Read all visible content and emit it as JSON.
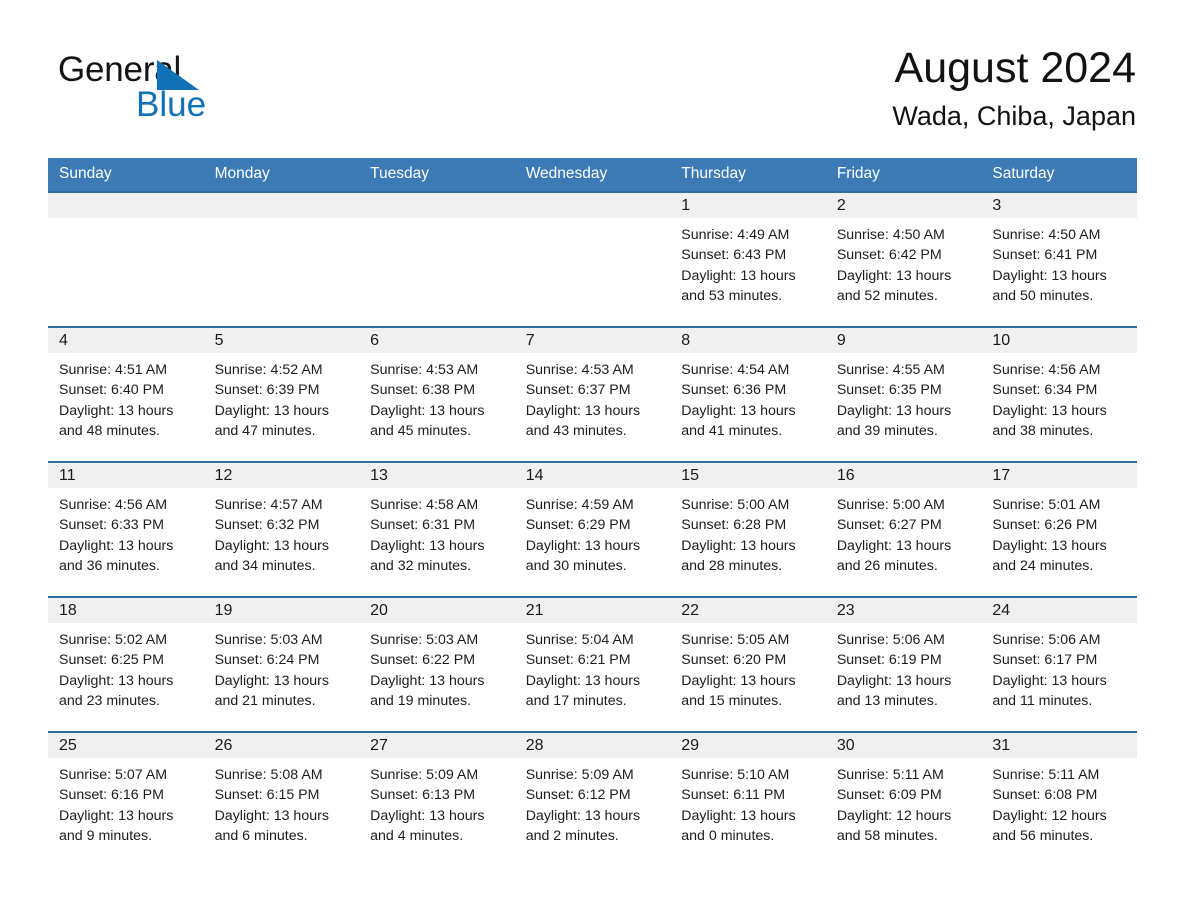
{
  "brand": {
    "name_part1": "General",
    "name_part2": "Blue",
    "triangle_icon": "triangle-icon",
    "accent_color": "#1272b8"
  },
  "header": {
    "month_title": "August 2024",
    "location": "Wada, Chiba, Japan",
    "header_bg_color": "#3b7ab4",
    "row_border_color": "#2e6da4",
    "daynum_band_color": "#f0f0f0"
  },
  "weekday_headers": [
    "Sunday",
    "Monday",
    "Tuesday",
    "Wednesday",
    "Thursday",
    "Friday",
    "Saturday"
  ],
  "labels": {
    "sunrise_prefix": "Sunrise:",
    "sunset_prefix": "Sunset:",
    "daylight_prefix": "Daylight:"
  },
  "weeks": [
    [
      {
        "day": "",
        "empty": true
      },
      {
        "day": "",
        "empty": true
      },
      {
        "day": "",
        "empty": true
      },
      {
        "day": "",
        "empty": true
      },
      {
        "day": "1",
        "sunrise": "Sunrise: 4:49 AM",
        "sunset": "Sunset: 6:43 PM",
        "daylight_line1": "Daylight: 13 hours",
        "daylight_line2": "and 53 minutes."
      },
      {
        "day": "2",
        "sunrise": "Sunrise: 4:50 AM",
        "sunset": "Sunset: 6:42 PM",
        "daylight_line1": "Daylight: 13 hours",
        "daylight_line2": "and 52 minutes."
      },
      {
        "day": "3",
        "sunrise": "Sunrise: 4:50 AM",
        "sunset": "Sunset: 6:41 PM",
        "daylight_line1": "Daylight: 13 hours",
        "daylight_line2": "and 50 minutes."
      }
    ],
    [
      {
        "day": "4",
        "sunrise": "Sunrise: 4:51 AM",
        "sunset": "Sunset: 6:40 PM",
        "daylight_line1": "Daylight: 13 hours",
        "daylight_line2": "and 48 minutes."
      },
      {
        "day": "5",
        "sunrise": "Sunrise: 4:52 AM",
        "sunset": "Sunset: 6:39 PM",
        "daylight_line1": "Daylight: 13 hours",
        "daylight_line2": "and 47 minutes."
      },
      {
        "day": "6",
        "sunrise": "Sunrise: 4:53 AM",
        "sunset": "Sunset: 6:38 PM",
        "daylight_line1": "Daylight: 13 hours",
        "daylight_line2": "and 45 minutes."
      },
      {
        "day": "7",
        "sunrise": "Sunrise: 4:53 AM",
        "sunset": "Sunset: 6:37 PM",
        "daylight_line1": "Daylight: 13 hours",
        "daylight_line2": "and 43 minutes."
      },
      {
        "day": "8",
        "sunrise": "Sunrise: 4:54 AM",
        "sunset": "Sunset: 6:36 PM",
        "daylight_line1": "Daylight: 13 hours",
        "daylight_line2": "and 41 minutes."
      },
      {
        "day": "9",
        "sunrise": "Sunrise: 4:55 AM",
        "sunset": "Sunset: 6:35 PM",
        "daylight_line1": "Daylight: 13 hours",
        "daylight_line2": "and 39 minutes."
      },
      {
        "day": "10",
        "sunrise": "Sunrise: 4:56 AM",
        "sunset": "Sunset: 6:34 PM",
        "daylight_line1": "Daylight: 13 hours",
        "daylight_line2": "and 38 minutes."
      }
    ],
    [
      {
        "day": "11",
        "sunrise": "Sunrise: 4:56 AM",
        "sunset": "Sunset: 6:33 PM",
        "daylight_line1": "Daylight: 13 hours",
        "daylight_line2": "and 36 minutes."
      },
      {
        "day": "12",
        "sunrise": "Sunrise: 4:57 AM",
        "sunset": "Sunset: 6:32 PM",
        "daylight_line1": "Daylight: 13 hours",
        "daylight_line2": "and 34 minutes."
      },
      {
        "day": "13",
        "sunrise": "Sunrise: 4:58 AM",
        "sunset": "Sunset: 6:31 PM",
        "daylight_line1": "Daylight: 13 hours",
        "daylight_line2": "and 32 minutes."
      },
      {
        "day": "14",
        "sunrise": "Sunrise: 4:59 AM",
        "sunset": "Sunset: 6:29 PM",
        "daylight_line1": "Daylight: 13 hours",
        "daylight_line2": "and 30 minutes."
      },
      {
        "day": "15",
        "sunrise": "Sunrise: 5:00 AM",
        "sunset": "Sunset: 6:28 PM",
        "daylight_line1": "Daylight: 13 hours",
        "daylight_line2": "and 28 minutes."
      },
      {
        "day": "16",
        "sunrise": "Sunrise: 5:00 AM",
        "sunset": "Sunset: 6:27 PM",
        "daylight_line1": "Daylight: 13 hours",
        "daylight_line2": "and 26 minutes."
      },
      {
        "day": "17",
        "sunrise": "Sunrise: 5:01 AM",
        "sunset": "Sunset: 6:26 PM",
        "daylight_line1": "Daylight: 13 hours",
        "daylight_line2": "and 24 minutes."
      }
    ],
    [
      {
        "day": "18",
        "sunrise": "Sunrise: 5:02 AM",
        "sunset": "Sunset: 6:25 PM",
        "daylight_line1": "Daylight: 13 hours",
        "daylight_line2": "and 23 minutes."
      },
      {
        "day": "19",
        "sunrise": "Sunrise: 5:03 AM",
        "sunset": "Sunset: 6:24 PM",
        "daylight_line1": "Daylight: 13 hours",
        "daylight_line2": "and 21 minutes."
      },
      {
        "day": "20",
        "sunrise": "Sunrise: 5:03 AM",
        "sunset": "Sunset: 6:22 PM",
        "daylight_line1": "Daylight: 13 hours",
        "daylight_line2": "and 19 minutes."
      },
      {
        "day": "21",
        "sunrise": "Sunrise: 5:04 AM",
        "sunset": "Sunset: 6:21 PM",
        "daylight_line1": "Daylight: 13 hours",
        "daylight_line2": "and 17 minutes."
      },
      {
        "day": "22",
        "sunrise": "Sunrise: 5:05 AM",
        "sunset": "Sunset: 6:20 PM",
        "daylight_line1": "Daylight: 13 hours",
        "daylight_line2": "and 15 minutes."
      },
      {
        "day": "23",
        "sunrise": "Sunrise: 5:06 AM",
        "sunset": "Sunset: 6:19 PM",
        "daylight_line1": "Daylight: 13 hours",
        "daylight_line2": "and 13 minutes."
      },
      {
        "day": "24",
        "sunrise": "Sunrise: 5:06 AM",
        "sunset": "Sunset: 6:17 PM",
        "daylight_line1": "Daylight: 13 hours",
        "daylight_line2": "and 11 minutes."
      }
    ],
    [
      {
        "day": "25",
        "sunrise": "Sunrise: 5:07 AM",
        "sunset": "Sunset: 6:16 PM",
        "daylight_line1": "Daylight: 13 hours",
        "daylight_line2": "and 9 minutes."
      },
      {
        "day": "26",
        "sunrise": "Sunrise: 5:08 AM",
        "sunset": "Sunset: 6:15 PM",
        "daylight_line1": "Daylight: 13 hours",
        "daylight_line2": "and 6 minutes."
      },
      {
        "day": "27",
        "sunrise": "Sunrise: 5:09 AM",
        "sunset": "Sunset: 6:13 PM",
        "daylight_line1": "Daylight: 13 hours",
        "daylight_line2": "and 4 minutes."
      },
      {
        "day": "28",
        "sunrise": "Sunrise: 5:09 AM",
        "sunset": "Sunset: 6:12 PM",
        "daylight_line1": "Daylight: 13 hours",
        "daylight_line2": "and 2 minutes."
      },
      {
        "day": "29",
        "sunrise": "Sunrise: 5:10 AM",
        "sunset": "Sunset: 6:11 PM",
        "daylight_line1": "Daylight: 13 hours",
        "daylight_line2": "and 0 minutes."
      },
      {
        "day": "30",
        "sunrise": "Sunrise: 5:11 AM",
        "sunset": "Sunset: 6:09 PM",
        "daylight_line1": "Daylight: 12 hours",
        "daylight_line2": "and 58 minutes."
      },
      {
        "day": "31",
        "sunrise": "Sunrise: 5:11 AM",
        "sunset": "Sunset: 6:08 PM",
        "daylight_line1": "Daylight: 12 hours",
        "daylight_line2": "and 56 minutes."
      }
    ]
  ]
}
